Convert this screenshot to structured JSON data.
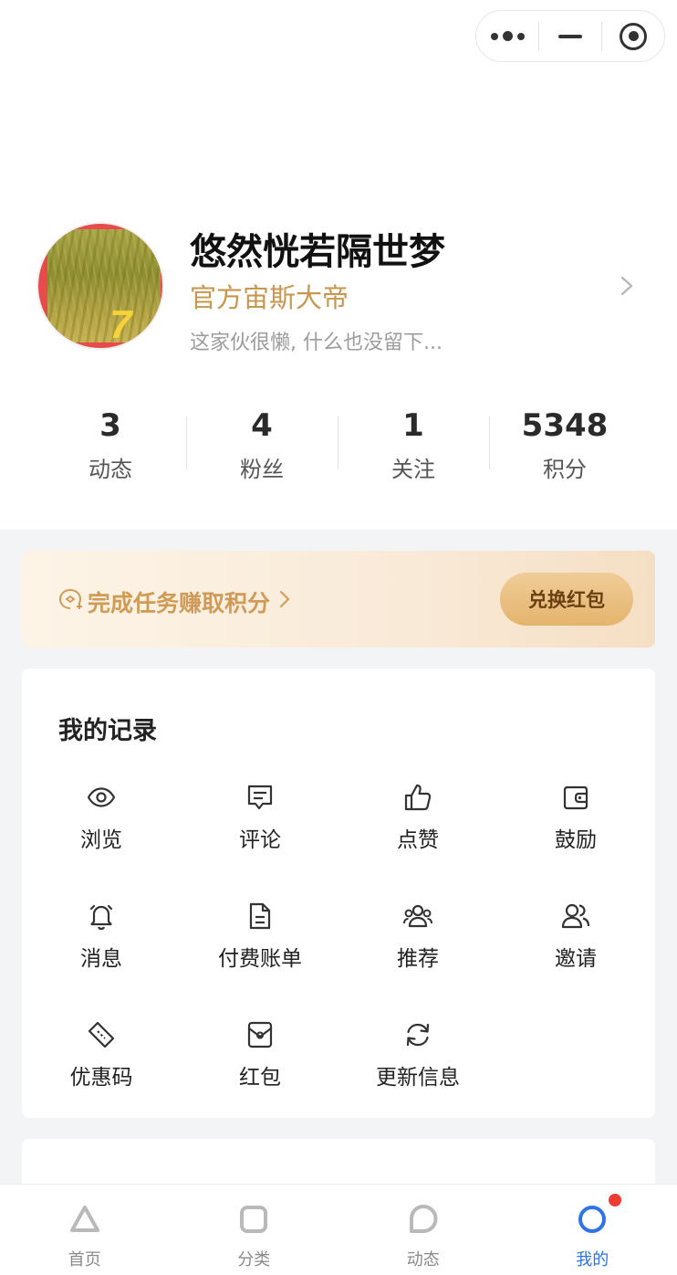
{
  "profile": {
    "username": "悠然恍若隔世梦",
    "role": "官方宙斯大帝",
    "bio": "这家伙很懒, 什么也没留下...",
    "avatar_text": "7"
  },
  "stats": [
    {
      "value": "3",
      "label": "动态"
    },
    {
      "value": "4",
      "label": "粉丝"
    },
    {
      "value": "1",
      "label": "关注"
    },
    {
      "value": "5348",
      "label": "积分"
    }
  ],
  "banner": {
    "task_label": "完成任务赚取积分",
    "exchange_label": "兑换红包",
    "icon": "coin-task-icon"
  },
  "records": {
    "title": "我的记录",
    "items": [
      {
        "label": "浏览",
        "icon": "eye-icon"
      },
      {
        "label": "评论",
        "icon": "comment-icon"
      },
      {
        "label": "点赞",
        "icon": "thumb-up-icon"
      },
      {
        "label": "鼓励",
        "icon": "wallet-icon"
      },
      {
        "label": "消息",
        "icon": "bell-icon"
      },
      {
        "label": "付费账单",
        "icon": "document-icon"
      },
      {
        "label": "推荐",
        "icon": "group-icon"
      },
      {
        "label": "邀请",
        "icon": "users-icon"
      },
      {
        "label": "优惠码",
        "icon": "ticket-icon"
      },
      {
        "label": "红包",
        "icon": "red-packet-icon"
      },
      {
        "label": "更新信息",
        "icon": "refresh-icon"
      }
    ]
  },
  "tabbar": [
    {
      "label": "首页",
      "icon": "triangle-icon"
    },
    {
      "label": "分类",
      "icon": "square-icon"
    },
    {
      "label": "动态",
      "icon": "bubble-icon"
    },
    {
      "label": "我的",
      "icon": "circle-icon",
      "active": true
    }
  ],
  "colors": {
    "accent_gold": "#c8974f",
    "active_blue": "#2f74e6",
    "badge_red": "#f03b34"
  }
}
